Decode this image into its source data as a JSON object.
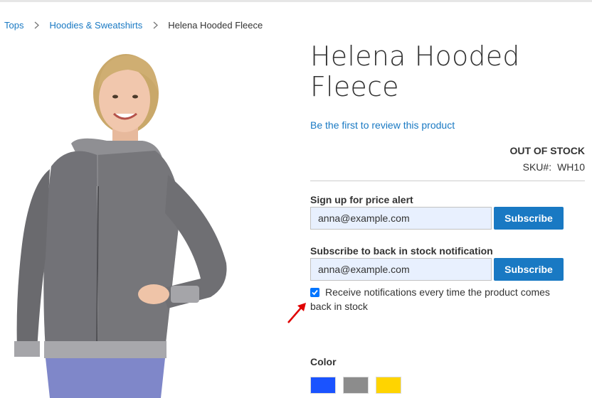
{
  "breadcrumb": {
    "items": [
      "Tops",
      "Hoodies & Sweatshirts"
    ],
    "current": "Helena Hooded Fleece"
  },
  "product": {
    "title": "Helena Hooded Fleece",
    "review_link": "Be the first to review this product",
    "stock_status": "OUT OF STOCK",
    "sku_label": "SKU#:",
    "sku_value": "WH10"
  },
  "price_alert": {
    "label": "Sign up for price alert",
    "email": "anna@example.com",
    "button": "Subscribe"
  },
  "stock_alert": {
    "label": "Subscribe to back in stock notification",
    "email": "anna@example.com",
    "button": "Subscribe",
    "checkbox_label": "Receive notifications every time the product comes back in stock",
    "checkbox_checked": true
  },
  "color": {
    "label": "Color",
    "swatches": [
      "#1a53ff",
      "#8c8c8c",
      "#ffd400"
    ]
  },
  "theme": {
    "link": "#1979c3",
    "button": "#1979c3",
    "input_bg": "#e8f0fe",
    "annotation_arrow": "#e00000"
  }
}
